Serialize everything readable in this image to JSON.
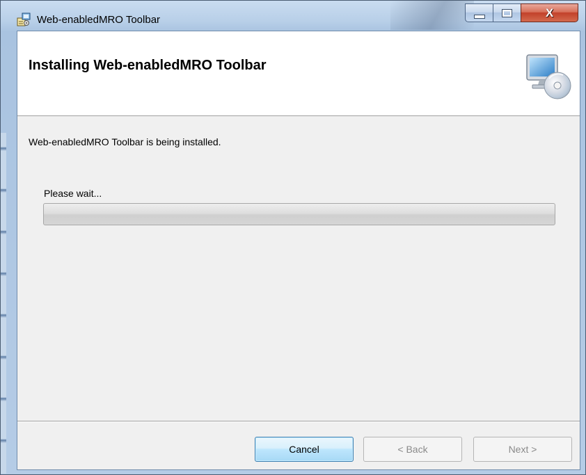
{
  "window": {
    "title": "Web-enabledMRO Toolbar",
    "controls": {
      "minimize_icon": "minimize-icon",
      "maximize_icon": "maximize-icon",
      "close_label": "X"
    }
  },
  "banner": {
    "title": "Installing Web-enabledMRO Toolbar",
    "icon": "computer-disc-icon"
  },
  "body": {
    "status_text": "Web-enabledMRO Toolbar is being installed.",
    "wait_text": "Please wait...",
    "progress": 0
  },
  "buttons": {
    "cancel": "Cancel",
    "back": "< Back",
    "next": "Next >"
  },
  "colors": {
    "close_button": "#c2412a",
    "default_button_border": "#3c7fb1",
    "disabled_text": "#8a8a8a"
  }
}
